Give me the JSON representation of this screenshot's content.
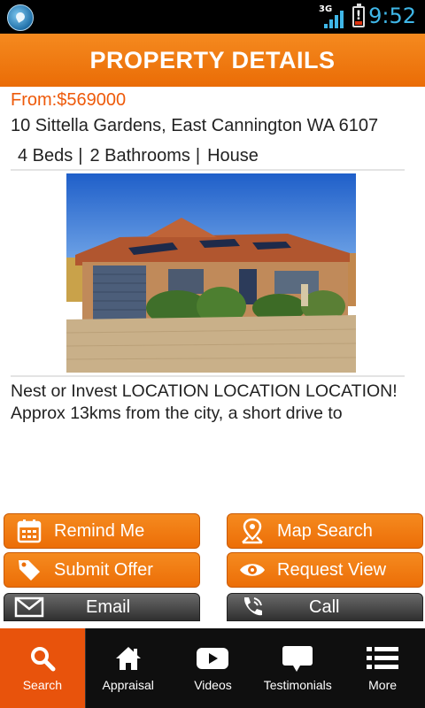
{
  "status_bar": {
    "network_label": "3G",
    "battery_alert": "!",
    "time": "9:52"
  },
  "header": {
    "title": "PROPERTY DETAILS"
  },
  "property": {
    "price": "From:$569000",
    "address": "10 Sittella Gardens, East Cannington WA 6107",
    "beds": "4 Beds",
    "baths": "2 Bathrooms",
    "type": "House",
    "separator": "|",
    "description": "Nest or Invest LOCATION LOCATION LOCATION! Approx 13kms from the city, a short drive to"
  },
  "actions": {
    "remind_me": "Remind Me",
    "map_search": "Map Search",
    "submit_offer": "Submit Offer",
    "request_view": "Request View",
    "email": "Email",
    "call": "Call"
  },
  "tabs": [
    {
      "label": "Search",
      "icon": "search-icon",
      "active": true
    },
    {
      "label": "Appraisal",
      "icon": "home-icon",
      "active": false
    },
    {
      "label": "Videos",
      "icon": "video-icon",
      "active": false
    },
    {
      "label": "Testimonials",
      "icon": "speech-bubble-icon",
      "active": false
    },
    {
      "label": "More",
      "icon": "list-icon",
      "active": false
    }
  ],
  "colors": {
    "accent": "#ee6b0a",
    "status_text": "#3fb7e8",
    "tabbar_bg": "#0f0f0f"
  }
}
